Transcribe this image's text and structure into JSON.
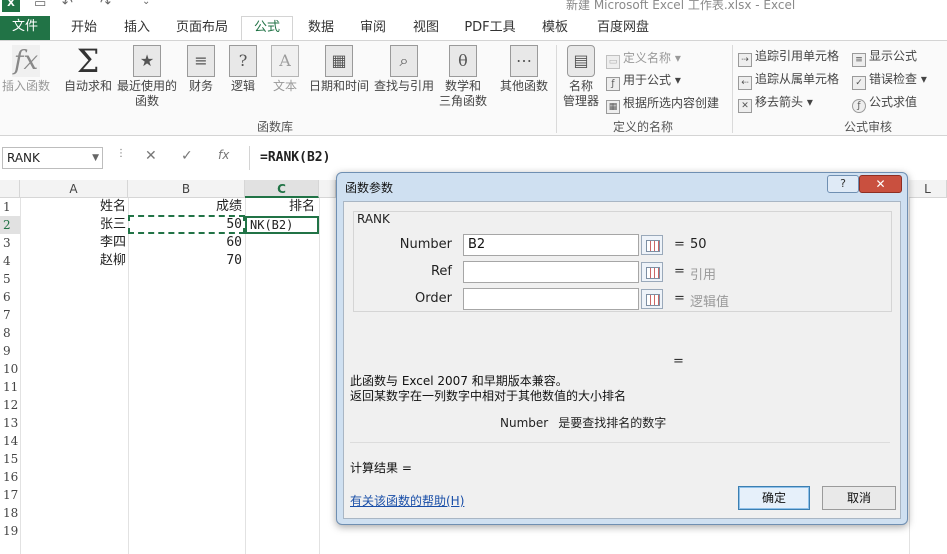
{
  "window": {
    "title": "新建 Microsoft Excel 工作表.xlsx - Excel",
    "logo": "X"
  },
  "qat": [
    "save-icon",
    "undo-icon",
    "redo-icon",
    "customize-icon"
  ],
  "tabs": [
    "文件",
    "开始",
    "插入",
    "页面布局",
    "公式",
    "数据",
    "审阅",
    "视图",
    "PDF工具",
    "模板",
    "百度网盘"
  ],
  "active_tab": "公式",
  "ribbon": {
    "insert_function": {
      "icon": "fx",
      "label": "插入函数"
    },
    "autosum": {
      "icon": "Σ",
      "label": "自动求和"
    },
    "recent": {
      "label1": "最近使用的",
      "label2": "函数"
    },
    "financial": "财务",
    "logical": "逻辑",
    "text": "文本",
    "datetime": "日期和时间",
    "lookup": "查找与引用",
    "math": {
      "label1": "数学和",
      "label2": "三角函数"
    },
    "other": "其他函数",
    "group_library": "函数库",
    "name_manager": {
      "label1": "名称",
      "label2": "管理器"
    },
    "define_name": "定义名称",
    "use_in_formula": "用于公式",
    "create_from_selection": "根据所选内容创建",
    "group_names": "定义的名称",
    "trace_precedents": "追踪引用单元格",
    "trace_dependents": "追踪从属单元格",
    "remove_arrows": "移去箭头",
    "show_formulas": "显示公式",
    "error_checking": "错误检查",
    "evaluate_formula": "公式求值",
    "group_audit": "公式审核"
  },
  "formula_bar": {
    "namebox": "RANK",
    "formula": "=RANK(B2)"
  },
  "grid": {
    "columns": [
      "A",
      "B",
      "C",
      "L"
    ],
    "active_column": "C",
    "rows": [
      "1",
      "2",
      "3",
      "4",
      "5",
      "6",
      "7",
      "8",
      "9",
      "10",
      "11",
      "12",
      "13",
      "14",
      "15",
      "16",
      "17",
      "18",
      "19"
    ],
    "active_row": "2",
    "cells": {
      "a1": "姓名",
      "b1": "成绩",
      "c1": "排名",
      "a2": "张三",
      "b2": "50",
      "c2": "NK(B2)",
      "a3": "李四",
      "b3": "60",
      "a4": "赵柳",
      "b4": "70"
    }
  },
  "dialog": {
    "title": "函数参数",
    "help_button": "?",
    "close_button": "✕",
    "function_name": "RANK",
    "args": [
      {
        "label": "Number",
        "value": "B2",
        "eq": "=",
        "result": "50"
      },
      {
        "label": "Ref",
        "value": "",
        "eq": "=",
        "result": "引用"
      },
      {
        "label": "Order",
        "value": "",
        "eq": "=",
        "result": "逻辑值"
      }
    ],
    "result_eq": "=",
    "desc1": "此函数与 Excel 2007 和早期版本兼容。",
    "desc2": "返回某数字在一列数字中相对于其他数值的大小排名",
    "arg_desc_name": "Number",
    "arg_desc_text": "是要查找排名的数字",
    "calc_result": "计算结果 =",
    "help_link": "有关该函数的帮助(H)",
    "ok": "确定",
    "cancel": "取消"
  }
}
